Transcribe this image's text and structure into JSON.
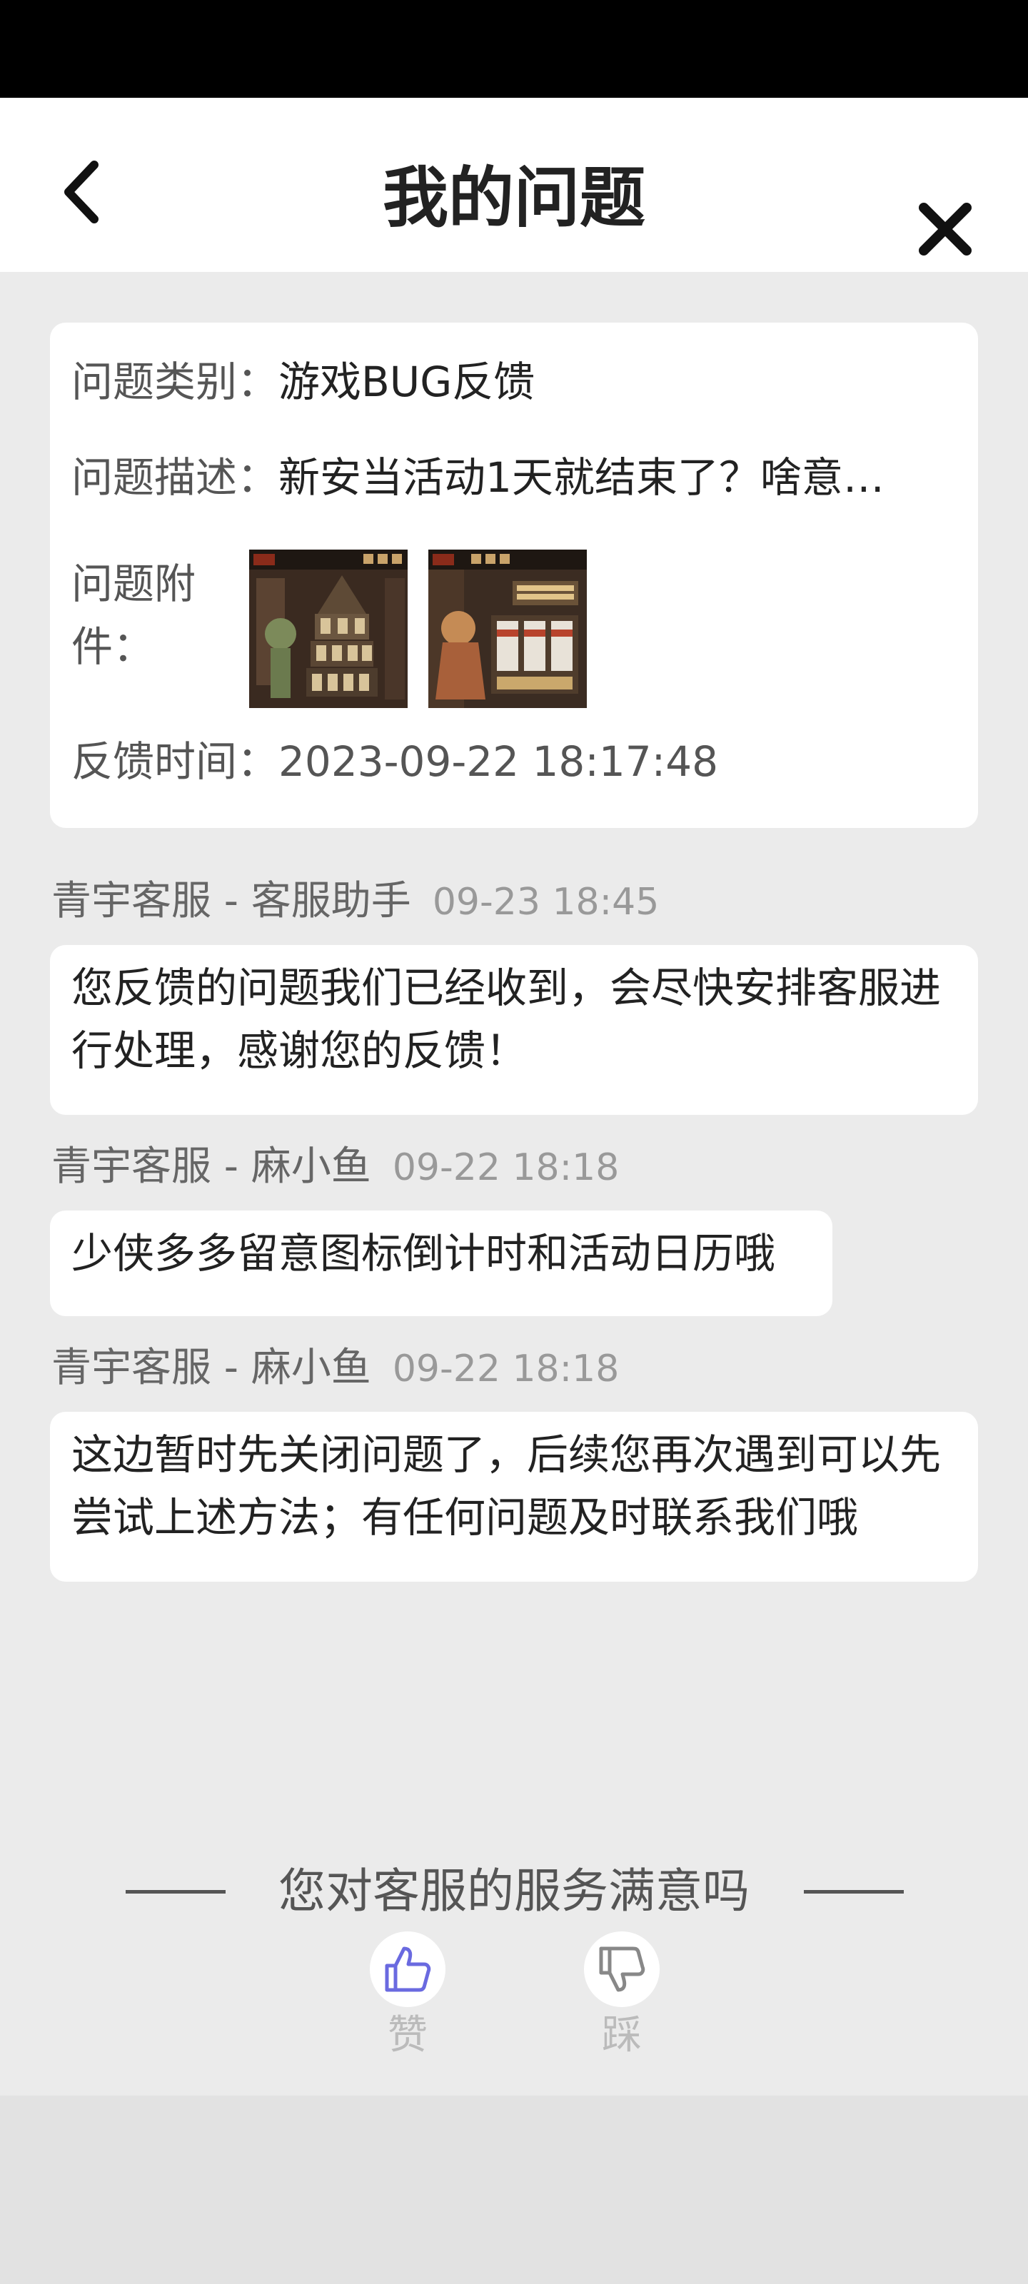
{
  "header": {
    "title": "我的问题"
  },
  "issue": {
    "category_label": "问题类别：",
    "category_value": "游戏BUG反馈",
    "description_label": "问题描述：",
    "description_value": "新安当活动1天就结束了？啥意…",
    "attachment_label": "问题附件：",
    "attachment_count": 2,
    "time_label": "反馈时间：",
    "time_value": "2023-09-22 18:17:48"
  },
  "messages": [
    {
      "sender": "青宇客服 - 客服助手",
      "time": "09-23 18:45",
      "text": "您反馈的问题我们已经收到，会尽快安排客服进行处理，感谢您的反馈！"
    },
    {
      "sender": "青宇客服 - 麻小鱼",
      "time": "09-22 18:18",
      "text": "少侠多多留意图标倒计时和活动日历哦"
    },
    {
      "sender": "青宇客服 - 麻小鱼",
      "time": "09-22 18:18",
      "text": "这边暂时先关闭问题了，后续您再次遇到可以先尝试上述方法；有任何问题及时联系我们哦"
    }
  ],
  "survey": {
    "question": "您对客服的服务满意吗",
    "like_label": "赞",
    "dislike_label": "踩"
  },
  "colors": {
    "like_icon": "#6a6ae0",
    "dislike_icon": "#888888"
  }
}
